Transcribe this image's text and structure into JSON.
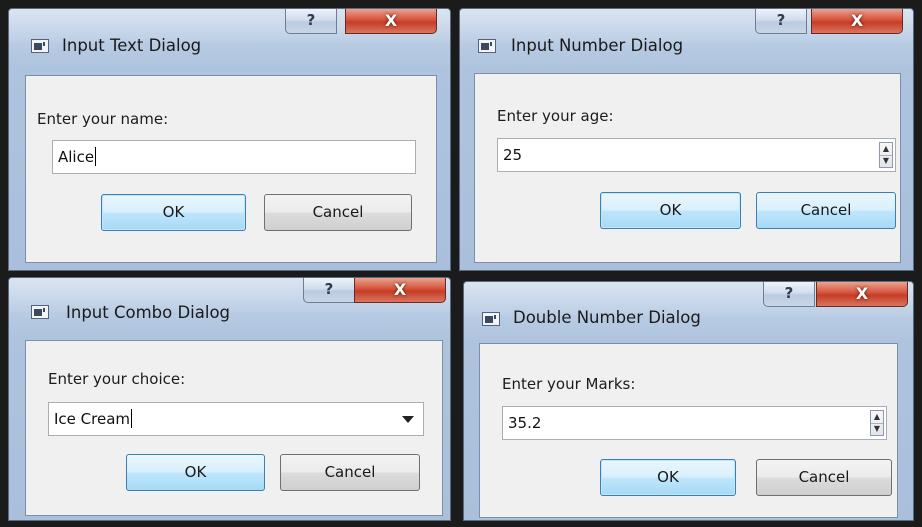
{
  "dialogs": {
    "text": {
      "title": "Input Text Dialog",
      "help_glyph": "?",
      "close_glyph": "X",
      "prompt": "Enter your name:",
      "value": "Alice",
      "ok_label": "OK",
      "cancel_label": "Cancel"
    },
    "number": {
      "title": "Input Number Dialog",
      "help_glyph": "?",
      "close_glyph": "X",
      "prompt": "Enter your age:",
      "value": "25",
      "spin_up": "▲",
      "spin_down": "▼",
      "ok_label": "OK",
      "cancel_label": "Cancel"
    },
    "combo": {
      "title": "Input Combo Dialog",
      "help_glyph": "?",
      "close_glyph": "X",
      "prompt": "Enter your choice:",
      "value": "Ice Cream",
      "ok_label": "OK",
      "cancel_label": "Cancel"
    },
    "double": {
      "title": "Double Number Dialog",
      "help_glyph": "?",
      "close_glyph": "X",
      "prompt": "Enter your Marks:",
      "value": "35.2",
      "spin_up": "▲",
      "spin_down": "▼",
      "ok_label": "OK",
      "cancel_label": "Cancel"
    }
  },
  "icons": {
    "app": "window-app-icon",
    "help": "help-icon",
    "close": "close-icon",
    "spin_up": "spin-up-arrow-icon",
    "spin_down": "spin-down-arrow-icon",
    "dropdown": "dropdown-arrow-icon"
  },
  "colors": {
    "title_bar": "#b9cde5",
    "client_background": "#f0f0f0",
    "close_button": "#c9442c",
    "default_button_border": "#3c7fb1",
    "button_highlight": "#bee6fd"
  }
}
